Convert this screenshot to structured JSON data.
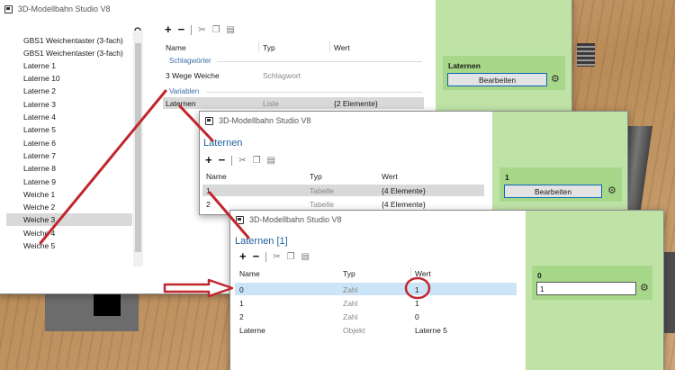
{
  "app_title": "3D-Modellbahn Studio V8",
  "title_buttons": {
    "help": "?",
    "close": "✕"
  },
  "toolbar": {
    "add": "+",
    "remove": "−"
  },
  "win1": {
    "search_icon": "search-icon",
    "list_items": [
      "GBS1 Weichentaster (3-fach)",
      "GBS1 Weichentaster (3-fach)",
      "Laterne 1",
      "Laterne 10",
      "Laterne 2",
      "Laterne 3",
      "Laterne 4",
      "Laterne 5",
      "Laterne 6",
      "Laterne 7",
      "Laterne 8",
      "Laterne 9",
      "Weiche 1",
      "Weiche 2",
      "Weiche 3",
      "Weiche 4",
      "Weiche 5"
    ],
    "selected_item": "Weiche 3",
    "columns": {
      "name": "Name",
      "type": "Typ",
      "value": "Wert"
    },
    "section_keywords": "Schlagwörter",
    "keyword_row": {
      "name": "3 Wege Weiche",
      "type": "Schlagwort"
    },
    "section_variables": "Variablen",
    "variable_row": {
      "name": "Laternen",
      "type": "Liste",
      "value": "{2 Elemente}"
    },
    "panel": {
      "title": "Laternen",
      "button": "Bearbeiten"
    }
  },
  "win2": {
    "heading": "Laternen",
    "columns": {
      "name": "Name",
      "type": "Typ",
      "value": "Wert"
    },
    "rows": [
      {
        "name": "1",
        "type": "Tabelle",
        "value": "{4 Elemente}"
      },
      {
        "name": "2",
        "type": "Tabelle",
        "value": "{4 Elemente}"
      }
    ],
    "panel": {
      "title": "1",
      "button": "Bearbeiten"
    }
  },
  "win3": {
    "heading": "Laternen [1]",
    "columns": {
      "name": "Name",
      "type": "Typ",
      "value": "Wert"
    },
    "rows": [
      {
        "name": "0",
        "type": "Zahl",
        "value": "1"
      },
      {
        "name": "1",
        "type": "Zahl",
        "value": "1"
      },
      {
        "name": "2",
        "type": "Zahl",
        "value": "0"
      },
      {
        "name": "Laterne",
        "type": "Objekt",
        "value": "Laterne 5"
      }
    ],
    "panel": {
      "title": "0",
      "input_value": "1"
    }
  },
  "colors": {
    "annotation_red": "#c0272d",
    "panel_green": "#bfe3a7",
    "box_green": "#a7d889",
    "heading_blue": "#1f5f9f",
    "selection_gray": "#d9d9d9",
    "selection_blue": "#cce4f7"
  }
}
